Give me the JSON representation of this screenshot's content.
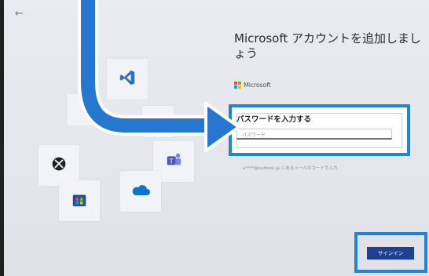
{
  "header": {
    "back_icon": "back-arrow-icon"
  },
  "dialog": {
    "title": "Microsoft アカウントを追加しましょう",
    "brand": "Microsoft",
    "password_heading": "パスワードを入力する",
    "password_placeholder": "パスワード",
    "hint": "a****@outlook.jp にあるメールのコードで入力",
    "signin_label": "サインイン"
  },
  "tiles": [
    "vscode-icon",
    "xbox-icon",
    "teams-icon",
    "store-icon",
    "onedrive-icon"
  ],
  "colors": {
    "highlight": "#1e86d4",
    "signin_button": "#1f3f93",
    "arrow": "#2577cf"
  }
}
